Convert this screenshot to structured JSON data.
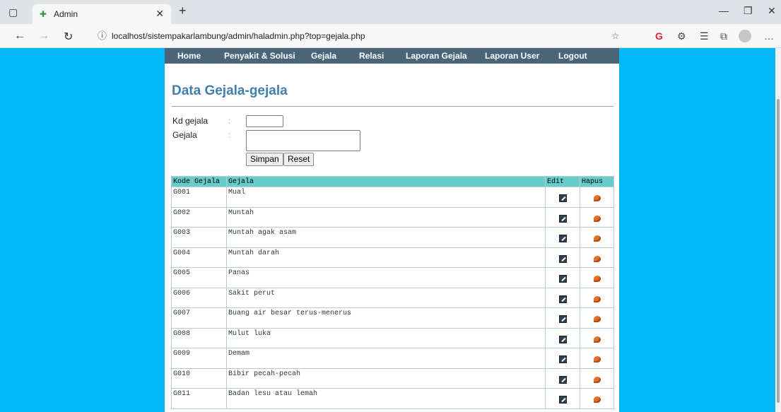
{
  "browser": {
    "tab_title": "Admin",
    "url": "localhost/sistempakarlambung/admin/haladmin.php?top=gejala.php"
  },
  "menu": [
    "Home",
    "Penyakit & Solusi",
    "Gejala",
    "Relasi",
    "Laporan Gejala",
    "Laporan User",
    "Logout"
  ],
  "page_title": "Data Gejala-gejala",
  "form": {
    "kd_label": "Kd gejala",
    "gejala_label": "Gejala",
    "colon": ":",
    "save_label": "Simpan",
    "reset_label": "Reset"
  },
  "table": {
    "headers": [
      "Kode Gejala",
      "Gejala",
      "Edit",
      "Hapus"
    ],
    "rows": [
      [
        "G001",
        "Mual"
      ],
      [
        "G002",
        "Muntah"
      ],
      [
        "G003",
        "Muntah agak asam"
      ],
      [
        "G004",
        "Muntah darah"
      ],
      [
        "G005",
        "Panas"
      ],
      [
        "G006",
        "Sakit perut"
      ],
      [
        "G007",
        "Buang air besar terus-menerus"
      ],
      [
        "G008",
        "Mulut luka"
      ],
      [
        "G009",
        "Demam"
      ],
      [
        "G010",
        "Bibir pecah-pecah"
      ],
      [
        "G011",
        "Badan lesu atau lemah"
      ]
    ]
  }
}
